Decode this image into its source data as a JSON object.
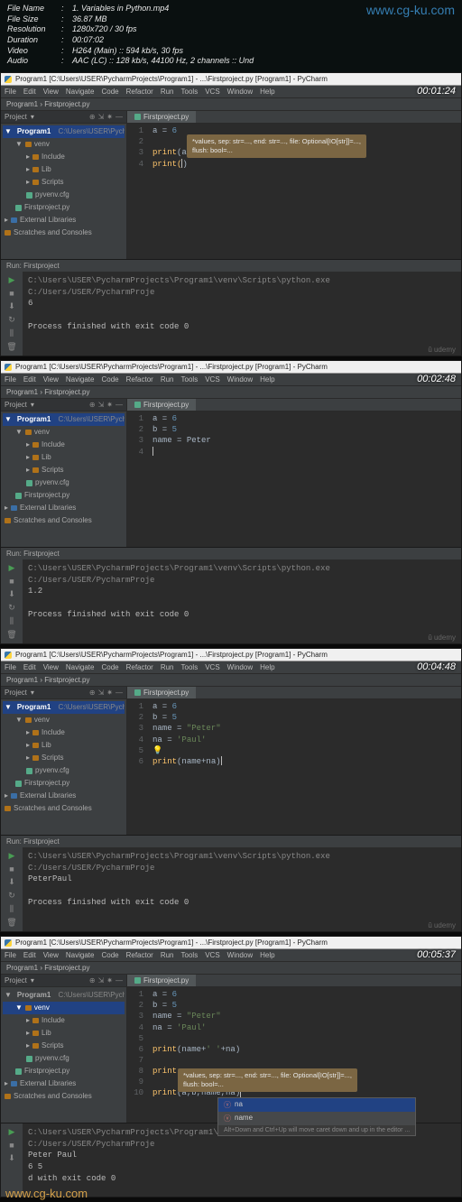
{
  "meta": {
    "filename_label": "File Name",
    "filename": "1. Variables in Python.mp4",
    "filesize_label": "File Size",
    "filesize": "36.87 MB",
    "resolution_label": "Resolution",
    "resolution": "1280x720 / 30 fps",
    "duration_label": "Duration",
    "duration": "00:07:02",
    "video_label": "Video",
    "video": "H264 (Main) :: 594 kb/s, 30 fps",
    "audio_label": "Audio",
    "audio": "AAC (LC) :: 128 kb/s, 44100 Hz, 2 channels :: Und"
  },
  "watermark_top": "www.cg-ku.com",
  "watermark_bottom": "www.cg-ku.com",
  "menus": [
    "File",
    "Edit",
    "View",
    "Navigate",
    "Code",
    "Refactor",
    "Run",
    "Tools",
    "VCS",
    "Window",
    "Help"
  ],
  "title_full": "Program1 [C:\\Users\\USER\\PycharmProjects\\Program1] - ...\\Firstproject.py [Program1] - PyCharm",
  "breadcrumb": "Program1  ›  Firstproject.py",
  "sidebar": {
    "header": "Project",
    "root": "Program1",
    "root_path": "C:\\Users\\USER\\PycharmProje",
    "venv": "venv",
    "include": "Include",
    "lib": "Lib",
    "scripts": "Scripts",
    "pyvenv": "pyvenv.cfg",
    "firstproject": "Firstproject.py",
    "ext_libs": "External Libraries",
    "scratches": "Scratches and Consoles"
  },
  "tab_name": "Firstproject.py",
  "tooltip1": {
    "line1": "*values, sep: str=..., end: str=..., file: Optional[IO[str]]=...,",
    "line2": "flush: bool=..."
  },
  "run_header": "Run:   Firstproject",
  "console_path": "C:\\Users\\USER\\PycharmProjects\\Program1\\venv\\Scripts\\python.exe C:/Users/USER/PycharmProje",
  "exit_msg": "Process finished with exit code 0",
  "footer_brand": "û udemy",
  "shots": {
    "s1": {
      "timestamp": "00:01:24",
      "code1": "a = ",
      "code1n": "6",
      "code2a": "print(",
      "code2b": "a)",
      "code3": "print(",
      "out": "6"
    },
    "s2": {
      "timestamp": "00:02:48",
      "l1a": "a = ",
      "l1b": "6",
      "l2a": "b = ",
      "l2b": "5",
      "l3a": "name = ",
      "l3b": "Peter",
      "out": "1.2"
    },
    "s3": {
      "timestamp": "00:04:48",
      "l1a": "a = ",
      "l1b": "6",
      "l2a": "b = ",
      "l2b": "5",
      "l3a": "name = ",
      "l3b": "\"Peter\"",
      "l4a": "na = ",
      "l4b": "'Paul'",
      "l6a": "print",
      "l6b": "(name+na)",
      "out": "PeterPaul"
    },
    "s4": {
      "timestamp": "00:05:37",
      "l1a": "a = ",
      "l1b": "6",
      "l2a": "b = ",
      "l2b": "5",
      "l3a": "name = ",
      "l3b": "\"Peter\"",
      "l4a": "na = ",
      "l4b": "'Paul'",
      "l6a": "print",
      "l6b": "(name+",
      "l6c": "' '",
      "l6d": "+na)",
      "l8a": "print",
      "l10a": "print",
      "l10b": "(a,b,name,na)",
      "ac1": "na",
      "ac2": "name",
      "ac_hint": "Alt+Down and Ctrl+Up will move caret down and up in the editor ...",
      "out1": "Peter Paul",
      "out2_prefix": "6 5 ",
      "out2_suffix": "d with exit code 0"
    }
  }
}
